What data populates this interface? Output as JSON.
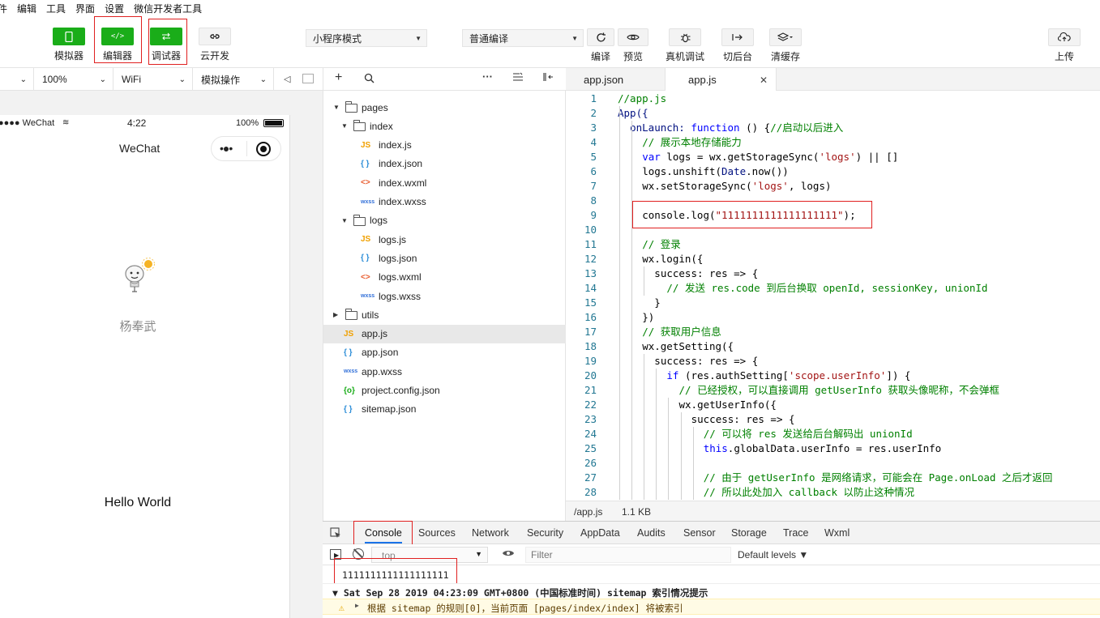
{
  "menu": [
    "件",
    "编辑",
    "工具",
    "界面",
    "设置",
    "微信开发者工具"
  ],
  "toolbar": {
    "simulator": "模拟器",
    "editor": "编辑器",
    "debugger": "调试器",
    "cloud": "云开发",
    "mode": "小程序模式",
    "compile_mode": "普通编译",
    "compile": "编译",
    "preview": "预览",
    "remote_debug": "真机调试",
    "background": "切后台",
    "clear_cache": "清缓存",
    "upload": "上传",
    "editor_icon": "</>"
  },
  "simbar": {
    "device": "",
    "zoom": "100%",
    "network": "WiFi",
    "ops": "模拟操作"
  },
  "phone": {
    "carrier": "●●●● WeChat",
    "time": "4:22",
    "battery": "100%",
    "nav_title": "WeChat",
    "nickname": "杨奉武",
    "hello": "Hello World"
  },
  "filetree": [
    {
      "name": "pages",
      "type": "folder",
      "depth": 0,
      "open": true
    },
    {
      "name": "index",
      "type": "folder",
      "depth": 1,
      "open": true
    },
    {
      "name": "index.js",
      "type": "js",
      "depth": 2
    },
    {
      "name": "index.json",
      "type": "json",
      "depth": 2
    },
    {
      "name": "index.wxml",
      "type": "wxml",
      "depth": 2
    },
    {
      "name": "index.wxss",
      "type": "wxss",
      "depth": 2
    },
    {
      "name": "logs",
      "type": "folder",
      "depth": 1,
      "open": true
    },
    {
      "name": "logs.js",
      "type": "js",
      "depth": 2
    },
    {
      "name": "logs.json",
      "type": "json",
      "depth": 2
    },
    {
      "name": "logs.wxml",
      "type": "wxml",
      "depth": 2
    },
    {
      "name": "logs.wxss",
      "type": "wxss",
      "depth": 2
    },
    {
      "name": "utils",
      "type": "folder",
      "depth": 0,
      "open": false
    },
    {
      "name": "app.js",
      "type": "js",
      "depth": 0,
      "selected": true
    },
    {
      "name": "app.json",
      "type": "json",
      "depth": 0
    },
    {
      "name": "app.wxss",
      "type": "wxss",
      "depth": 0
    },
    {
      "name": "project.config.json",
      "type": "config",
      "depth": 0
    },
    {
      "name": "sitemap.json",
      "type": "json",
      "depth": 0
    }
  ],
  "file_icons": {
    "js": "JS",
    "json": "{ }",
    "wxml": "<>",
    "wxss": "wxss",
    "config": "{o}"
  },
  "editor_tabs": [
    {
      "label": "app.json",
      "active": false
    },
    {
      "label": "app.js",
      "active": true,
      "close": "✕"
    }
  ],
  "code": [
    {
      "n": "1",
      "indent": 0,
      "parts": [
        [
          "com",
          "//app.js"
        ]
      ]
    },
    {
      "n": "2",
      "indent": 0,
      "parts": [
        [
          "fn",
          "App({"
        ]
      ]
    },
    {
      "n": "3",
      "indent": 1,
      "parts": [
        [
          "fn",
          "onLaunch: "
        ],
        [
          "kw",
          "function"
        ],
        [
          "",
          " () {"
        ],
        [
          "com",
          "//启动以后进入"
        ]
      ]
    },
    {
      "n": "4",
      "indent": 2,
      "parts": [
        [
          "com",
          "// 展示本地存储能力"
        ]
      ]
    },
    {
      "n": "5",
      "indent": 2,
      "parts": [
        [
          "kw",
          "var"
        ],
        [
          "",
          " logs = wx.getStorageSync("
        ],
        [
          "str",
          "'logs'"
        ],
        [
          "",
          ") || []"
        ]
      ]
    },
    {
      "n": "6",
      "indent": 2,
      "parts": [
        [
          "",
          "logs.unshift("
        ],
        [
          "fn",
          "Date"
        ],
        [
          "",
          ".now())"
        ]
      ]
    },
    {
      "n": "7",
      "indent": 2,
      "parts": [
        [
          "",
          "wx.setStorageSync("
        ],
        [
          "str",
          "'logs'"
        ],
        [
          "",
          ", logs)"
        ]
      ]
    },
    {
      "n": "8",
      "indent": 2,
      "parts": []
    },
    {
      "n": "9",
      "indent": 2,
      "parts": [
        [
          "",
          "console.log("
        ],
        [
          "str",
          "\"1111111111111111111\""
        ],
        [
          "",
          ");"
        ]
      ]
    },
    {
      "n": "10",
      "indent": 2,
      "parts": []
    },
    {
      "n": "11",
      "indent": 2,
      "parts": [
        [
          "com",
          "// 登录"
        ]
      ]
    },
    {
      "n": "12",
      "indent": 2,
      "parts": [
        [
          "",
          "wx.login({"
        ]
      ]
    },
    {
      "n": "13",
      "indent": 3,
      "parts": [
        [
          "",
          "success: res => {"
        ]
      ]
    },
    {
      "n": "14",
      "indent": 4,
      "parts": [
        [
          "com",
          "// 发送 res.code 到后台换取 openId, sessionKey, unionId"
        ]
      ]
    },
    {
      "n": "15",
      "indent": 3,
      "parts": [
        [
          "",
          "}"
        ]
      ]
    },
    {
      "n": "16",
      "indent": 2,
      "parts": [
        [
          "",
          "})"
        ]
      ]
    },
    {
      "n": "17",
      "indent": 2,
      "parts": [
        [
          "com",
          "// 获取用户信息"
        ]
      ]
    },
    {
      "n": "18",
      "indent": 2,
      "parts": [
        [
          "",
          "wx.getSetting({"
        ]
      ]
    },
    {
      "n": "19",
      "indent": 3,
      "parts": [
        [
          "",
          "success: res => {"
        ]
      ]
    },
    {
      "n": "20",
      "indent": 4,
      "parts": [
        [
          "kw",
          "if"
        ],
        [
          "",
          " (res.authSetting["
        ],
        [
          "str",
          "'scope.userInfo'"
        ],
        [
          "",
          "]) {"
        ]
      ]
    },
    {
      "n": "21",
      "indent": 5,
      "parts": [
        [
          "com",
          "// 已经授权，可以直接调用 getUserInfo 获取头像昵称，不会弹框"
        ]
      ]
    },
    {
      "n": "22",
      "indent": 5,
      "parts": [
        [
          "",
          "wx.getUserInfo({"
        ]
      ]
    },
    {
      "n": "23",
      "indent": 6,
      "parts": [
        [
          "",
          "success: res => {"
        ]
      ]
    },
    {
      "n": "24",
      "indent": 7,
      "parts": [
        [
          "com",
          "// 可以将 res 发送给后台解码出 unionId"
        ]
      ]
    },
    {
      "n": "25",
      "indent": 7,
      "parts": [
        [
          "kw",
          "this"
        ],
        [
          "",
          ".globalData.userInfo = res.userInfo"
        ]
      ]
    },
    {
      "n": "26",
      "indent": 7,
      "parts": []
    },
    {
      "n": "27",
      "indent": 7,
      "parts": [
        [
          "com",
          "// 由于 getUserInfo 是网络请求，可能会在 Page.onLoad 之后才返回"
        ]
      ]
    },
    {
      "n": "28",
      "indent": 7,
      "parts": [
        [
          "com",
          "// 所以此处加入 callback 以防止这种情况"
        ]
      ]
    }
  ],
  "footer": {
    "path": "/app.js",
    "size": "1.1 KB"
  },
  "devtools": {
    "tabs": [
      "Console",
      "Sources",
      "Network",
      "Security",
      "AppData",
      "Audits",
      "Sensor",
      "Storage",
      "Trace",
      "Wxml"
    ],
    "context": "top",
    "filter_placeholder": "Filter",
    "levels": "Default levels ▼"
  },
  "console": {
    "output": "1111111111111111111",
    "group": "▼ Sat Sep 28 2019 04:23:09 GMT+0800 (中国标准时间) sitemap 索引情况提示",
    "warning": "根据 sitemap 的规则[0]，当前页面 [pages/index/index] 将被索引"
  },
  "colors": {
    "green": "#1aad19",
    "red": "#e02020",
    "accent": "#1a73e8"
  }
}
